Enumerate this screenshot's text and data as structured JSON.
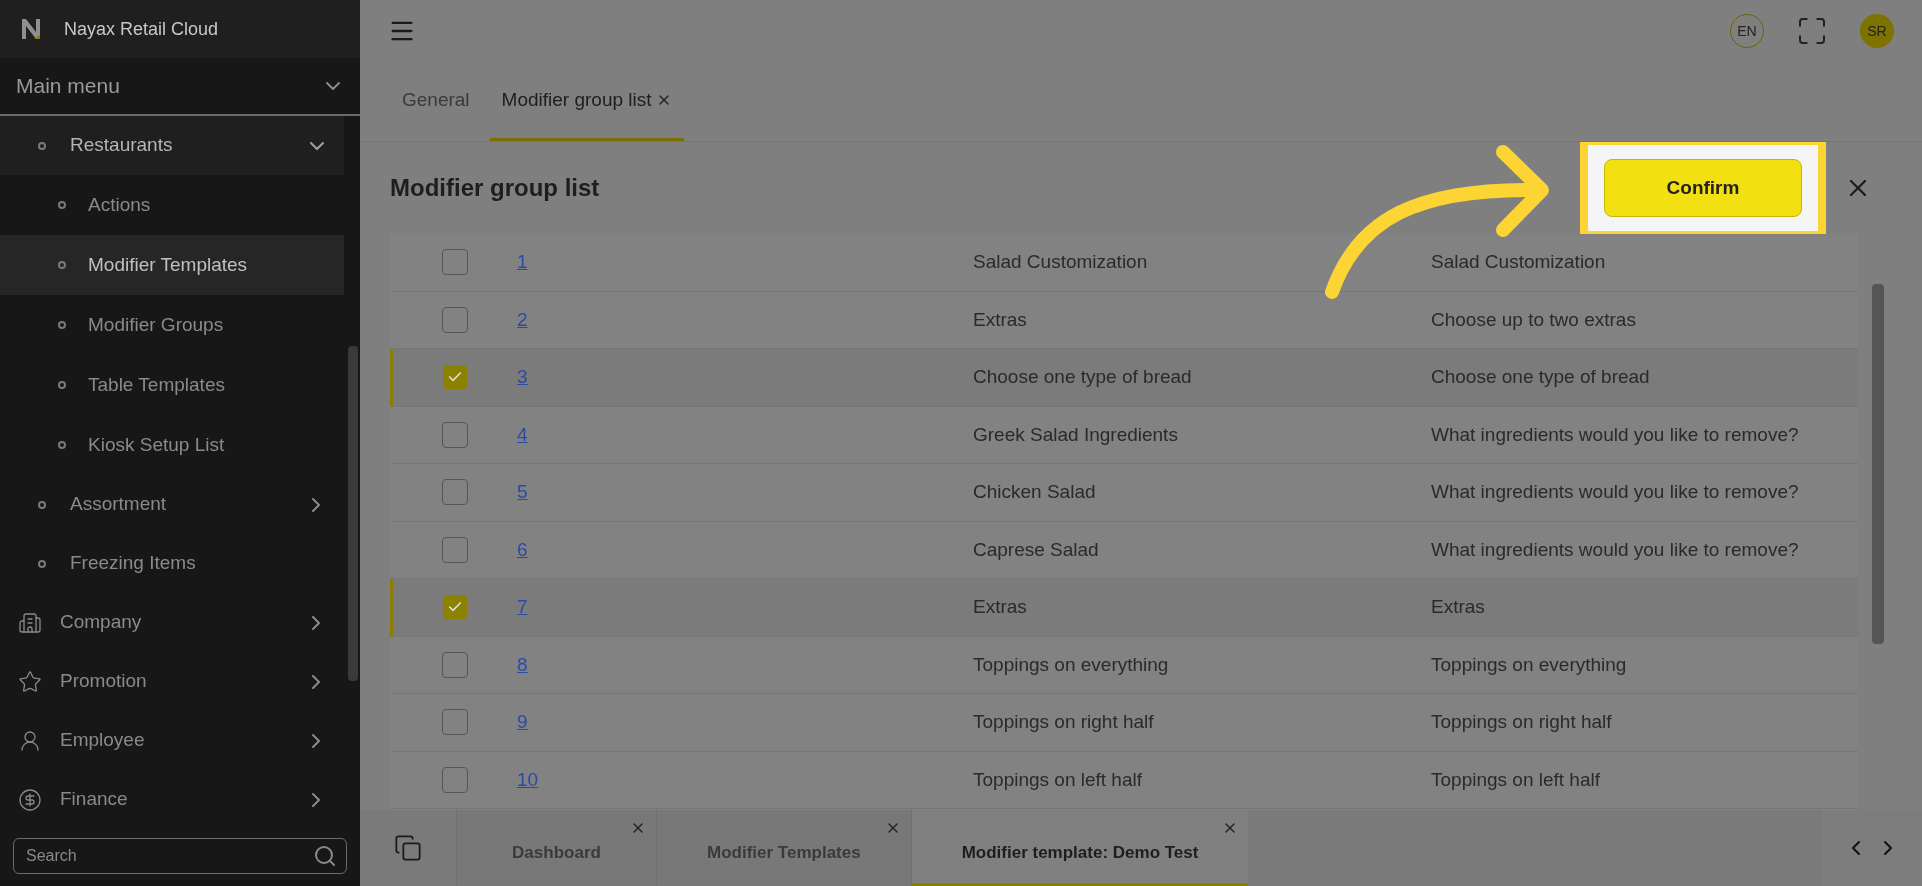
{
  "app": {
    "title": "Nayax Retail Cloud"
  },
  "sidebar": {
    "menu_title": "Main menu",
    "search_placeholder": "Search",
    "items": [
      {
        "label": "Restaurants",
        "kind": "bullet",
        "expanded": true,
        "children": [
          {
            "label": "Actions",
            "selected": false
          },
          {
            "label": "Modifier Templates",
            "selected": true
          },
          {
            "label": "Modifier Groups",
            "selected": false
          },
          {
            "label": "Table Templates",
            "selected": false
          },
          {
            "label": "Kiosk Setup List",
            "selected": false
          }
        ]
      },
      {
        "label": "Assortment",
        "kind": "bullet",
        "expanded": false
      },
      {
        "label": "Freezing Items",
        "kind": "leaf"
      },
      {
        "label": "Company",
        "kind": "building",
        "expanded": false
      },
      {
        "label": "Promotion",
        "kind": "star",
        "expanded": false
      },
      {
        "label": "Employee",
        "kind": "person",
        "expanded": false
      },
      {
        "label": "Finance",
        "kind": "money",
        "expanded": false
      }
    ]
  },
  "top_bar": {
    "language": "EN",
    "avatar": "SR"
  },
  "tabs": [
    {
      "label": "General",
      "selected": false,
      "closable": false
    },
    {
      "label": "Modifier group list",
      "selected": true,
      "closable": true
    }
  ],
  "dialog": {
    "title": "Modifier group list",
    "confirm": "Confirm",
    "rows": [
      {
        "id": "1",
        "name": "Salad Customization",
        "description": "Salad Customization",
        "selected": false
      },
      {
        "id": "2",
        "name": "Extras",
        "description": "Choose up to two extras",
        "selected": false
      },
      {
        "id": "3",
        "name": "Choose one type of bread",
        "description": "Choose one type of bread",
        "selected": true
      },
      {
        "id": "4",
        "name": "Greek Salad Ingredients",
        "description": "What ingredients would you like to remove?",
        "selected": false
      },
      {
        "id": "5",
        "name": "Chicken Salad",
        "description": "What ingredients would you like to remove?",
        "selected": false
      },
      {
        "id": "6",
        "name": "Caprese Salad",
        "description": "What ingredients would you like to remove?",
        "selected": false
      },
      {
        "id": "7",
        "name": "Extras",
        "description": "Extras",
        "selected": true
      },
      {
        "id": "8",
        "name": "Toppings on everything",
        "description": "Toppings on everything",
        "selected": false
      },
      {
        "id": "9",
        "name": "Toppings on right half",
        "description": "Toppings on right half",
        "selected": false
      },
      {
        "id": "10",
        "name": "Toppings on left half",
        "description": "Toppings on left half",
        "selected": false
      }
    ]
  },
  "bottom_tabs": [
    {
      "label": "Dashboard",
      "selected": false
    },
    {
      "label": "Modifier Templates",
      "selected": false
    },
    {
      "label": "Modifier template: Demo Test",
      "selected": true
    }
  ]
}
